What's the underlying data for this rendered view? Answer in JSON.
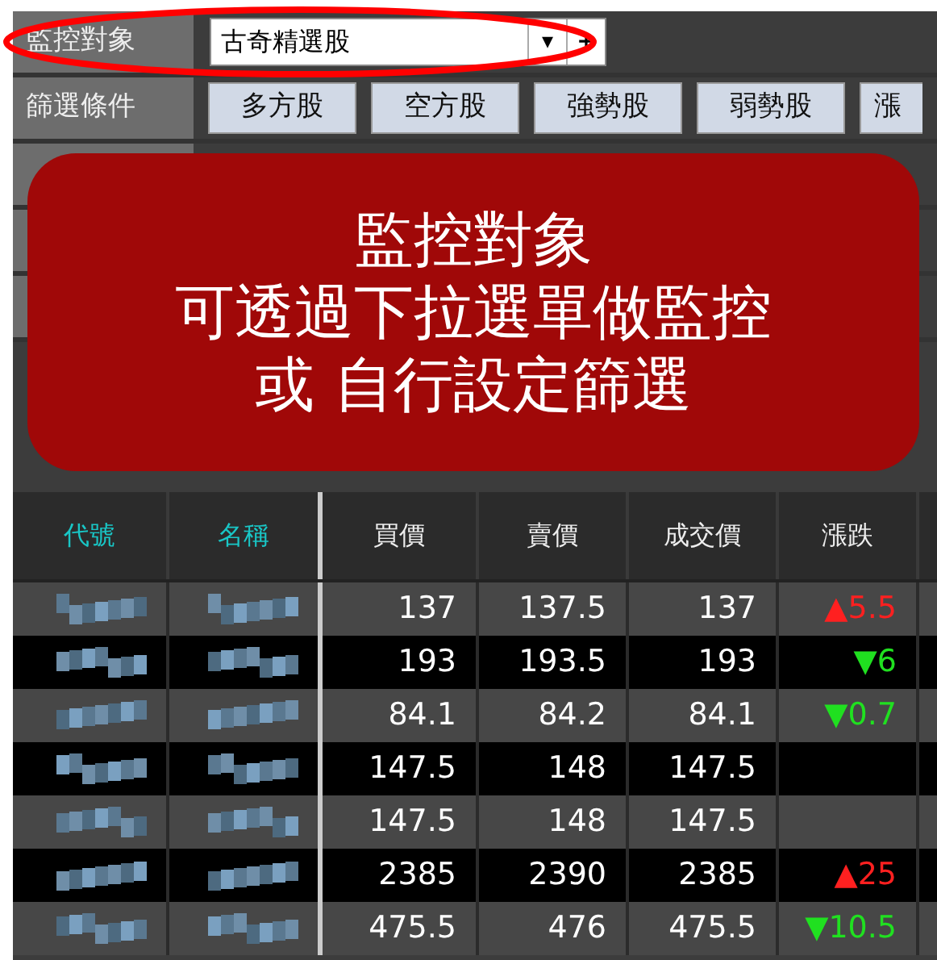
{
  "monitor": {
    "label": "監控對象",
    "value": "古奇精選股",
    "dropdown_glyph": "▾",
    "add_glyph": "+"
  },
  "filter_rows": [
    {
      "label": "篩選條件",
      "buttons": [
        "多方股",
        "空方股",
        "強勢股",
        "弱勢股",
        "漲"
      ]
    }
  ],
  "callout": {
    "lines": [
      "監控對象",
      "可透過下拉選單做監控",
      "或 自行設定篩選"
    ]
  },
  "table": {
    "columns": [
      "代號",
      "名稱",
      "買價",
      "賣價",
      "成交價",
      "漲跌"
    ],
    "rows": [
      {
        "bid": "137",
        "ask": "137.5",
        "last": "137",
        "change": "▲5.5",
        "color": "#ff2020"
      },
      {
        "bid": "193",
        "ask": "193.5",
        "last": "193",
        "change": "▼6",
        "color": "#20e020"
      },
      {
        "bid": "84.1",
        "ask": "84.2",
        "last": "84.1",
        "change": "▼0.7",
        "color": "#20e020"
      },
      {
        "bid": "147.5",
        "ask": "148",
        "last": "147.5"
      },
      {
        "bid": "147.5",
        "ask": "148",
        "last": "147.5"
      },
      {
        "bid": "2385",
        "ask": "2390",
        "last": "2385",
        "change": "▲25",
        "color": "#ff2020"
      },
      {
        "bid": "475.5",
        "ask": "476",
        "last": "475.5",
        "change": "▼10.5",
        "color": "#20e020"
      }
    ]
  }
}
